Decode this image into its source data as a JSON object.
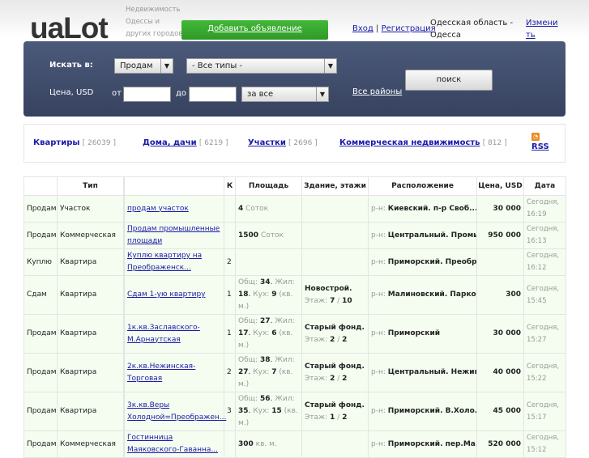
{
  "header": {
    "logo": "uaLot",
    "tagline": "Недвижимость Одессы и других городов",
    "add_button": "Добавить объявление",
    "login": "Вход",
    "separator": "|",
    "register": "Регистрация",
    "region": "Одесская область - Одесса",
    "change": "Изменить"
  },
  "search": {
    "search_in_label": "Искать в:",
    "deal_select": "Продам",
    "type_select": "- Все типы -",
    "price_label": "Цена, USD",
    "from_label": "от",
    "to_label": "до",
    "from_value": "",
    "to_value": "",
    "period_select": "за все",
    "all_districts": "Все районы",
    "search_button": "поиск"
  },
  "categories": [
    {
      "name": "Квартиры",
      "count": "[ 26039 ]"
    },
    {
      "name": "Дома, дачи",
      "count": "[ 6219 ]"
    },
    {
      "name": "Участки",
      "count": "[ 2696 ]"
    },
    {
      "name": "Коммерческая недвижимость",
      "count": "[ 812 ]"
    }
  ],
  "rss": "RSS",
  "table": {
    "headers": [
      "",
      "Тип",
      "",
      "",
      "К",
      "Площадь",
      "Здание, этажи",
      "Расположение",
      "Цена, USD",
      "Дата"
    ],
    "rows": [
      {
        "deal": "Продам",
        "type": "Участок",
        "title": "продам участок",
        "rooms": "",
        "area_value": "4",
        "area_unit": "Соток",
        "building": "",
        "floor": "",
        "floors": "",
        "district_prefix": "р-н:",
        "location": "Киевский. п-р Своб...",
        "price": "30 000",
        "date": "Сегодня, 16:19"
      },
      {
        "deal": "Продам",
        "type": "Коммерческая",
        "title": "Продам промышленные площади",
        "rooms": "",
        "area_value": "1500",
        "area_unit": "Соток",
        "building": "",
        "floor": "",
        "floors": "",
        "district_prefix": "р-н:",
        "location": "Центральный. Промы...",
        "price": "950 000",
        "date": "Сегодня, 16:13"
      },
      {
        "deal": "Куплю",
        "type": "Квартира",
        "title": "Куплю квартиру на Преображенск...",
        "rooms": "2",
        "building": "",
        "floor": "",
        "floors": "",
        "district_prefix": "р-н:",
        "location": "Приморский. Преобр...",
        "price": "",
        "date": "Сегодня, 16:12"
      },
      {
        "deal": "Сдам",
        "type": "Квартира",
        "title": "Сдам 1-ую квартиру",
        "rooms": "1",
        "total": "34",
        "living": "18",
        "kitchen": "9",
        "unit": "(кв. м.)",
        "building": "Новострой.",
        "floor": "7",
        "floors": "10",
        "district_prefix": "р-н:",
        "location": "Малиновский. Парко...",
        "price": "300",
        "date": "Сегодня, 15:45"
      },
      {
        "deal": "Продам",
        "type": "Квартира",
        "title": "1к.кв.Заславского-М.Арнаутская",
        "rooms": "1",
        "total": "27",
        "living": "17",
        "kitchen": "6",
        "unit": "(кв. м.)",
        "building": "Старый фонд.",
        "floor": "2",
        "floors": "2",
        "district_prefix": "р-н:",
        "location": "Приморский",
        "price": "30 000",
        "date": "Сегодня, 15:27"
      },
      {
        "deal": "Продам",
        "type": "Квартира",
        "title": "2к.кв.Нежинская-Торговая",
        "rooms": "2",
        "total": "38",
        "living": "27",
        "kitchen": "7",
        "unit": "(кв. м.)",
        "building": "Старый фонд.",
        "floor": "2",
        "floors": "2",
        "district_prefix": "р-н:",
        "location": "Центральный. Нежин...",
        "price": "40 000",
        "date": "Сегодня, 15:22"
      },
      {
        "deal": "Продам",
        "type": "Квартира",
        "title": "3к.кв.Веры Холодной=Преображен...",
        "rooms": "3",
        "total": "56",
        "living": "35",
        "kitchen": "15",
        "unit": "(кв. м.)",
        "building": "Старый фонд.",
        "floor": "1",
        "floors": "2",
        "district_prefix": "р-н:",
        "location": "Приморский. В.Холо...",
        "price": "45 000",
        "date": "Сегодня, 15:17"
      },
      {
        "deal": "Продам",
        "type": "Коммерческая",
        "title": "Гостинница Маяковского-Гаванна...",
        "rooms": "",
        "area_value": "300",
        "area_unit": "кв. м.",
        "building": "",
        "floor": "",
        "floors": "",
        "district_prefix": "р-н:",
        "location": "Приморский. пер.Ма...",
        "price": "520 000",
        "date": "Сегодня, 15:12"
      }
    ],
    "labels": {
      "total": "Общ:",
      "living": "Жил:",
      "kitchen": "Кух:",
      "floor": "Этаж:",
      "slash": "/"
    }
  }
}
